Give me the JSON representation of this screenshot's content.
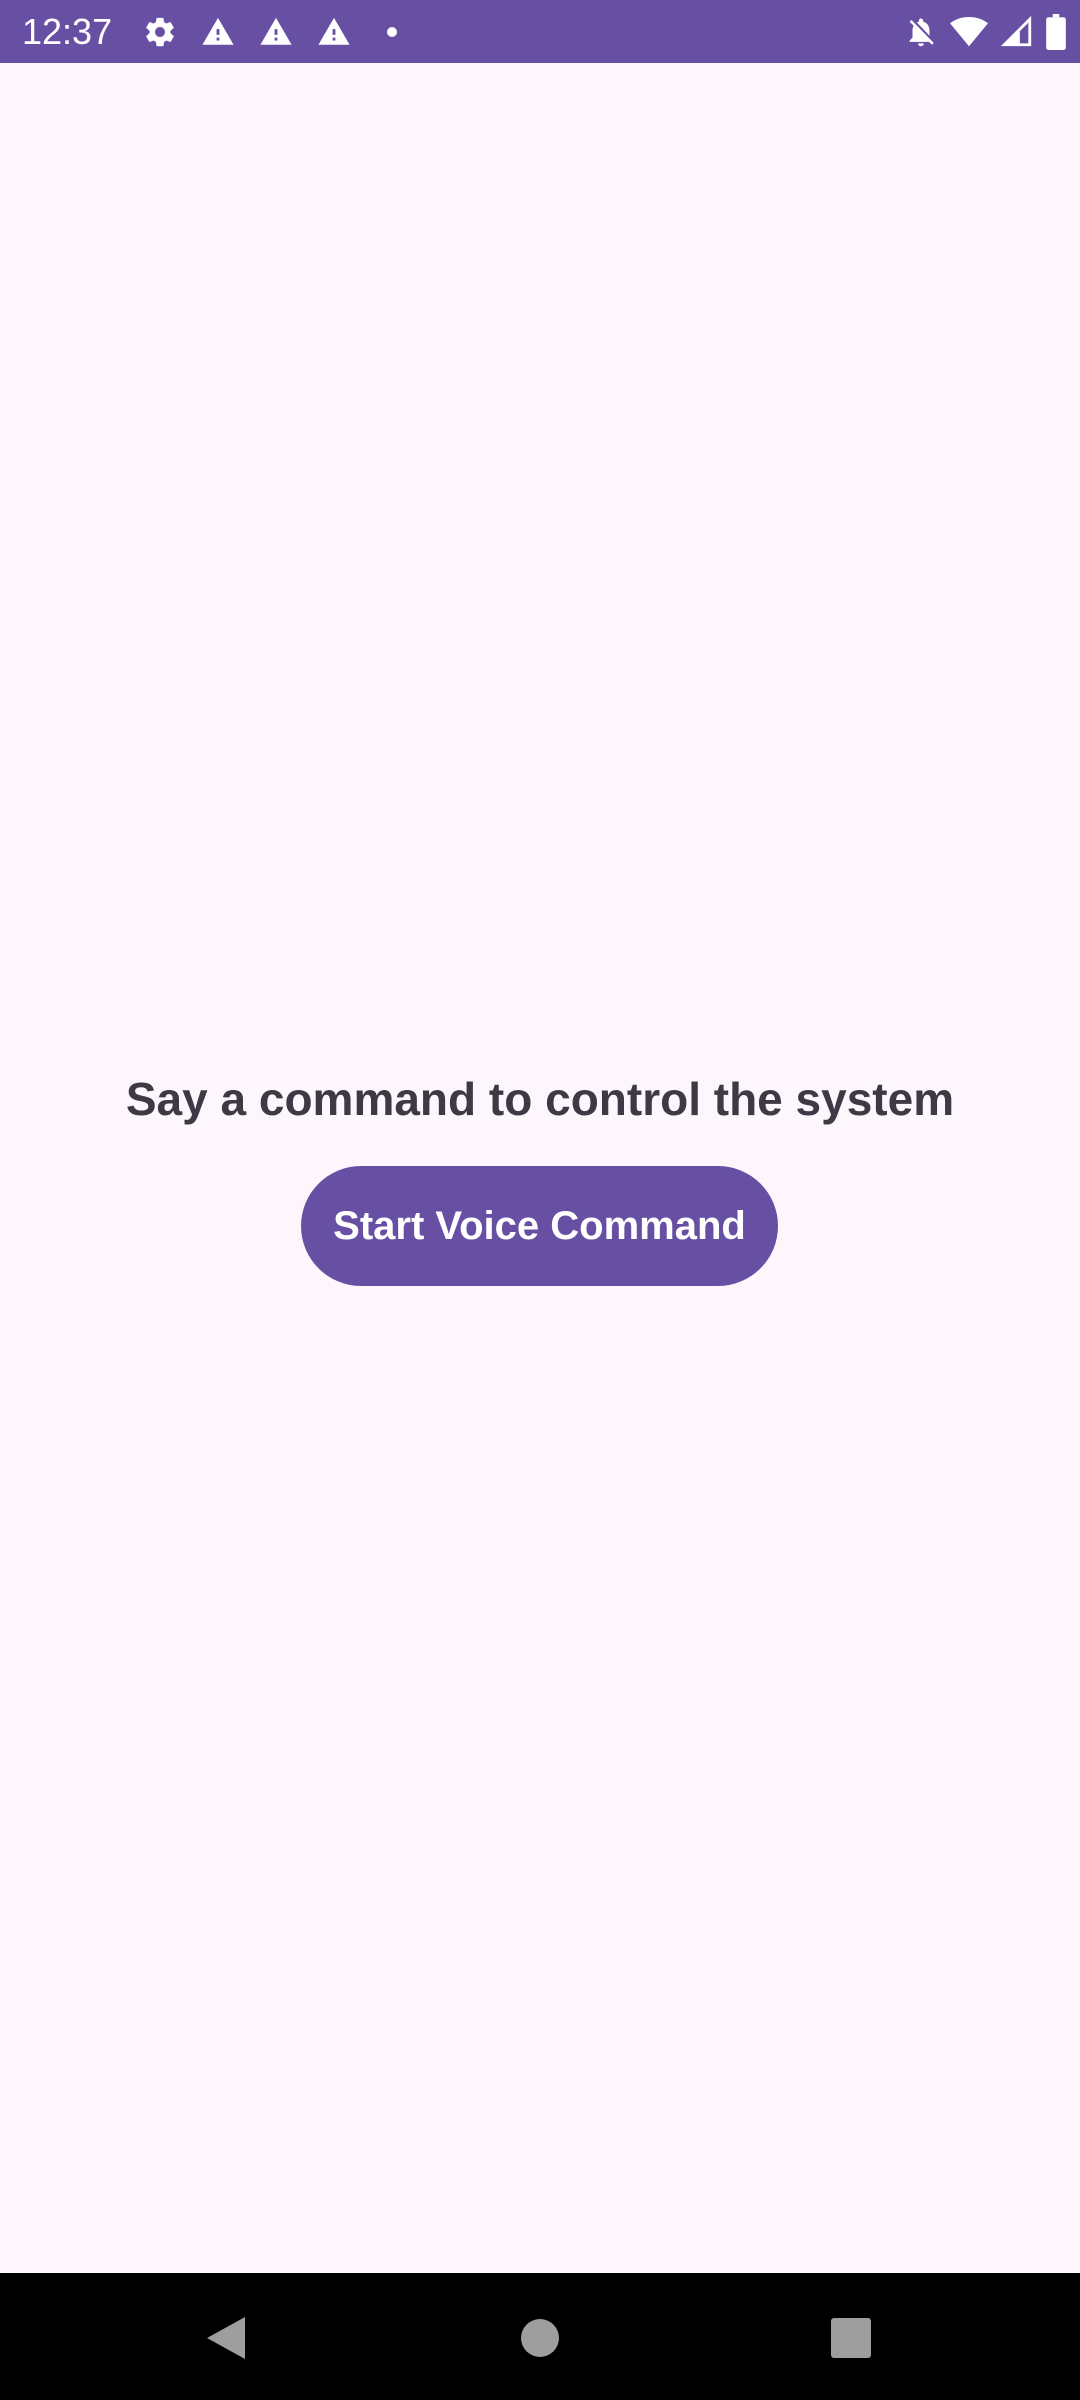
{
  "status_bar": {
    "time": "12:37",
    "background_color": "#6750A4",
    "left_icons": [
      "gear-icon",
      "warning-icon",
      "warning-icon",
      "warning-icon",
      "dot-icon"
    ],
    "right_icons": [
      "notifications-off-icon",
      "wifi-icon",
      "cell-signal-icon",
      "battery-icon"
    ]
  },
  "main": {
    "prompt_text": "Say a command to control the system",
    "button_label": "Start Voice Command",
    "accent_color": "#6750A4",
    "background_color": "#FDF7FD"
  },
  "nav_bar": {
    "buttons": [
      "back-icon",
      "home-icon",
      "recents-icon"
    ]
  }
}
